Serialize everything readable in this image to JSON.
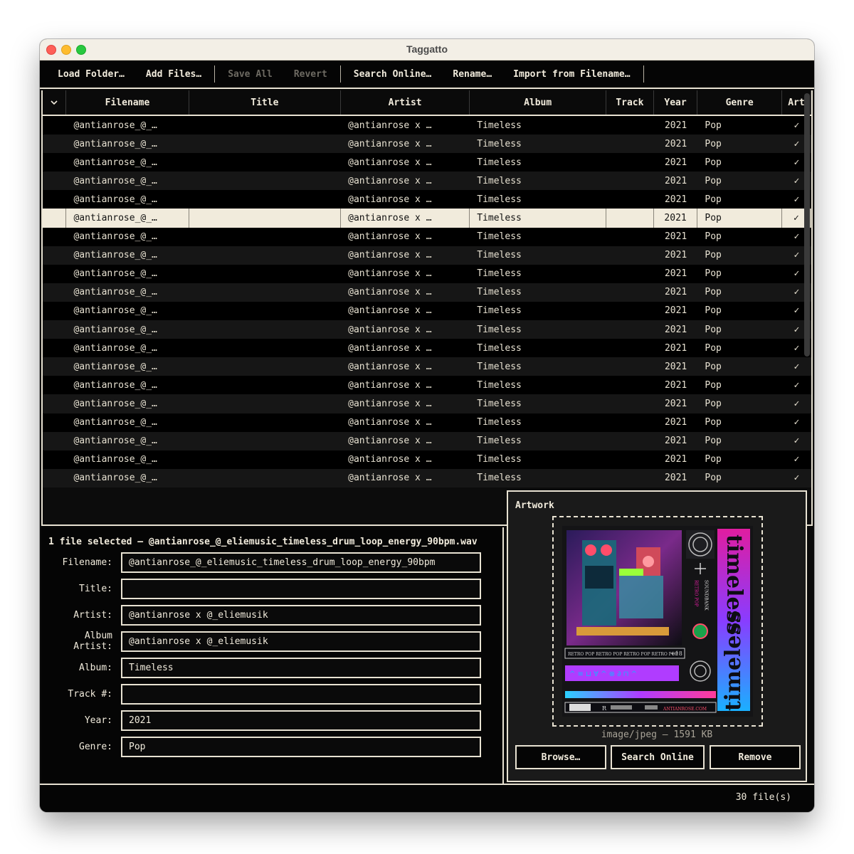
{
  "window": {
    "title": "Taggatto"
  },
  "toolbar": {
    "load_folder": "Load Folder…",
    "add_files": "Add Files…",
    "save_all": "Save All",
    "revert": "Revert",
    "search_online": "Search Online…",
    "rename": "Rename…",
    "import_from_filename": "Import from Filename…"
  },
  "table": {
    "columns": [
      "Filename",
      "Title",
      "Artist",
      "Album",
      "Track",
      "Year",
      "Genre",
      "Art"
    ],
    "rows": [
      {
        "filename": "@antianrose_@_…",
        "title": "",
        "artist": "@antianrose x …",
        "album": "Timeless",
        "track": "",
        "year": "2021",
        "genre": "Pop",
        "art": "✓"
      },
      {
        "filename": "@antianrose_@_…",
        "title": "",
        "artist": "@antianrose x …",
        "album": "Timeless",
        "track": "",
        "year": "2021",
        "genre": "Pop",
        "art": "✓"
      },
      {
        "filename": "@antianrose_@_…",
        "title": "",
        "artist": "@antianrose x …",
        "album": "Timeless",
        "track": "",
        "year": "2021",
        "genre": "Pop",
        "art": "✓"
      },
      {
        "filename": "@antianrose_@_…",
        "title": "",
        "artist": "@antianrose x …",
        "album": "Timeless",
        "track": "",
        "year": "2021",
        "genre": "Pop",
        "art": "✓"
      },
      {
        "filename": "@antianrose_@_…",
        "title": "",
        "artist": "@antianrose x …",
        "album": "Timeless",
        "track": "",
        "year": "2021",
        "genre": "Pop",
        "art": "✓"
      },
      {
        "filename": "@antianrose_@_…",
        "title": "",
        "artist": "@antianrose x …",
        "album": "Timeless",
        "track": "",
        "year": "2021",
        "genre": "Pop",
        "art": "✓",
        "selected": true
      },
      {
        "filename": "@antianrose_@_…",
        "title": "",
        "artist": "@antianrose x …",
        "album": "Timeless",
        "track": "",
        "year": "2021",
        "genre": "Pop",
        "art": "✓"
      },
      {
        "filename": "@antianrose_@_…",
        "title": "",
        "artist": "@antianrose x …",
        "album": "Timeless",
        "track": "",
        "year": "2021",
        "genre": "Pop",
        "art": "✓"
      },
      {
        "filename": "@antianrose_@_…",
        "title": "",
        "artist": "@antianrose x …",
        "album": "Timeless",
        "track": "",
        "year": "2021",
        "genre": "Pop",
        "art": "✓"
      },
      {
        "filename": "@antianrose_@_…",
        "title": "",
        "artist": "@antianrose x …",
        "album": "Timeless",
        "track": "",
        "year": "2021",
        "genre": "Pop",
        "art": "✓"
      },
      {
        "filename": "@antianrose_@_…",
        "title": "",
        "artist": "@antianrose x …",
        "album": "Timeless",
        "track": "",
        "year": "2021",
        "genre": "Pop",
        "art": "✓"
      },
      {
        "filename": "@antianrose_@_…",
        "title": "",
        "artist": "@antianrose x …",
        "album": "Timeless",
        "track": "",
        "year": "2021",
        "genre": "Pop",
        "art": "✓"
      },
      {
        "filename": "@antianrose_@_…",
        "title": "",
        "artist": "@antianrose x …",
        "album": "Timeless",
        "track": "",
        "year": "2021",
        "genre": "Pop",
        "art": "✓"
      },
      {
        "filename": "@antianrose_@_…",
        "title": "",
        "artist": "@antianrose x …",
        "album": "Timeless",
        "track": "",
        "year": "2021",
        "genre": "Pop",
        "art": "✓"
      },
      {
        "filename": "@antianrose_@_…",
        "title": "",
        "artist": "@antianrose x …",
        "album": "Timeless",
        "track": "",
        "year": "2021",
        "genre": "Pop",
        "art": "✓"
      },
      {
        "filename": "@antianrose_@_…",
        "title": "",
        "artist": "@antianrose x …",
        "album": "Timeless",
        "track": "",
        "year": "2021",
        "genre": "Pop",
        "art": "✓"
      },
      {
        "filename": "@antianrose_@_…",
        "title": "",
        "artist": "@antianrose x …",
        "album": "Timeless",
        "track": "",
        "year": "2021",
        "genre": "Pop",
        "art": "✓"
      },
      {
        "filename": "@antianrose_@_…",
        "title": "",
        "artist": "@antianrose x …",
        "album": "Timeless",
        "track": "",
        "year": "2021",
        "genre": "Pop",
        "art": "✓"
      },
      {
        "filename": "@antianrose_@_…",
        "title": "",
        "artist": "@antianrose x …",
        "album": "Timeless",
        "track": "",
        "year": "2021",
        "genre": "Pop",
        "art": "✓"
      },
      {
        "filename": "@antianrose_@_…",
        "title": "",
        "artist": "@antianrose x …",
        "album": "Timeless",
        "track": "",
        "year": "2021",
        "genre": "Pop",
        "art": "✓"
      }
    ]
  },
  "editor": {
    "selection_label": "1 file selected — @antianrose_@_eliemusic_timeless_drum_loop_energy_90bpm.wav",
    "fields": [
      {
        "label": "Filename:",
        "value": "@antianrose_@_eliemusic_timeless_drum_loop_energy_90bpm"
      },
      {
        "label": "Title:",
        "value": ""
      },
      {
        "label": "Artist:",
        "value": "@antianrose x @_eliemusik"
      },
      {
        "label": "Album Artist:",
        "value": "@antianrose x @_eliemusik"
      },
      {
        "label": "Album:",
        "value": "Timeless"
      },
      {
        "label": "Track #:",
        "value": ""
      },
      {
        "label": "Year:",
        "value": "2021"
      },
      {
        "label": "Genre:",
        "value": "Pop"
      }
    ]
  },
  "artwork": {
    "title": "Artwork",
    "info": "image/jpeg — 1591 KB",
    "cover_text": {
      "title_top": "timeless",
      "title_bottom": "timeless",
      "side_text": "SOUNDBANK",
      "side_text_2": "RETRO POP",
      "strip": "RETRO POP RETRO POP RETRO POP RETRO POP",
      "age": "+18",
      "logo": "R",
      "site": "ANTIANROSE.COM"
    },
    "browse": "Browse…",
    "search_online": "Search Online",
    "remove": "Remove"
  },
  "status": {
    "count": "30 file(s)"
  },
  "colors": {
    "background": "#0a0a0a",
    "accent": "#f1ebdc",
    "selected_row": "#f1ebdc"
  }
}
